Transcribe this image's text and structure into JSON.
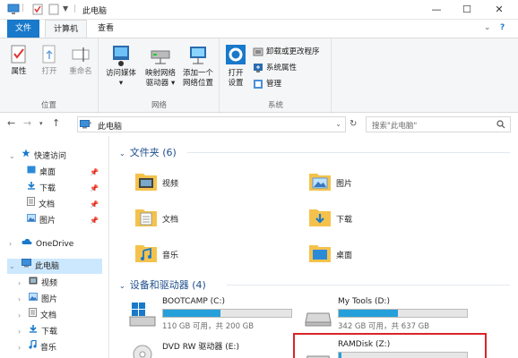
{
  "window": {
    "title": "此电脑",
    "minimize": "—",
    "maximize": "☐",
    "close": "✕"
  },
  "tabs": [
    {
      "label": "文件"
    },
    {
      "label": "计算机"
    },
    {
      "label": "查看"
    }
  ],
  "ribbon": {
    "location": {
      "label": "位置",
      "buttons": [
        "属性",
        "打开",
        "重命名"
      ]
    },
    "network": {
      "label": "网络",
      "access_media": "访问媒体",
      "map_drive_1": "映射网络",
      "map_drive_2": "驱动器",
      "add_location_1": "添加一个",
      "add_location_2": "网络位置"
    },
    "system": {
      "label": "系统",
      "open_settings_1": "打开",
      "open_settings_2": "设置",
      "uninstall": "卸载或更改程序",
      "sys_props": "系统属性",
      "manage": "管理"
    }
  },
  "address": {
    "location": "此电脑",
    "search_placeholder": "搜索\"此电脑\""
  },
  "nav": {
    "quick_access": "快速访问",
    "quick_items": [
      "桌面",
      "下载",
      "文档",
      "图片"
    ],
    "onedrive": "OneDrive",
    "this_pc": "此电脑",
    "pc_items": [
      "视频",
      "图片",
      "文档",
      "下载",
      "音乐"
    ]
  },
  "folders": {
    "header": "文件夹 (6)",
    "items": [
      "视频",
      "图片",
      "文档",
      "下载",
      "音乐",
      "桌面"
    ]
  },
  "drives": {
    "header": "设备和驱动器 (4)",
    "items": [
      {
        "name": "BOOTCAMP (C:)",
        "free": "110 GB 可用，共 200 GB",
        "used_fraction": 0.45
      },
      {
        "name": "My Tools (D:)",
        "free": "342 GB 可用，共 637 GB",
        "used_fraction": 0.46
      },
      {
        "name": "DVD RW 驱动器 (E:)",
        "free": "",
        "used_fraction": 0
      },
      {
        "name": "RAMDisk (Z:)",
        "free": "",
        "used_fraction": 0.02
      }
    ]
  },
  "colors": {
    "accent": "#1979ca",
    "bar_fill": "#26a0da",
    "highlight": "#d9252a",
    "selected_nav": "#cce8ff"
  }
}
